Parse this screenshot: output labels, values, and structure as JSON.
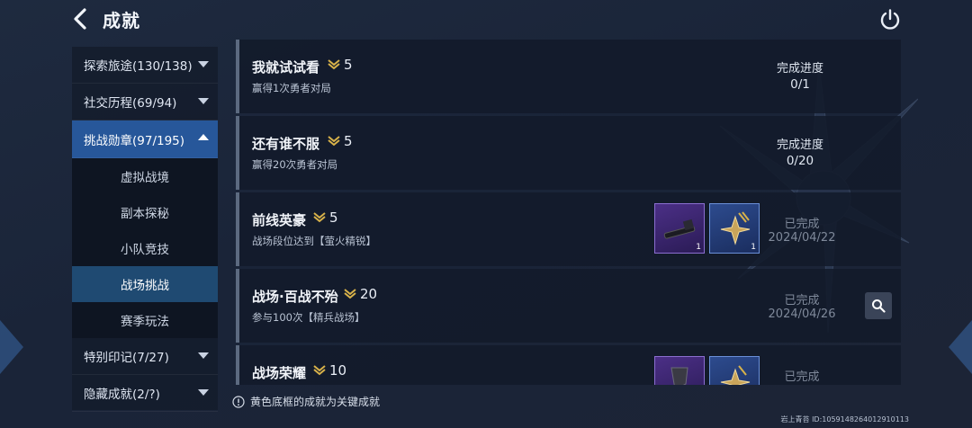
{
  "header": {
    "title": "成就"
  },
  "sidebar": {
    "categories_top": [
      {
        "label": "探索旅途(130/138)"
      },
      {
        "label": "社交历程(69/94)"
      },
      {
        "label": "挑战勋章(97/195)"
      }
    ],
    "sub_items": [
      {
        "label": "虚拟战境"
      },
      {
        "label": "副本探秘"
      },
      {
        "label": "小队竞技"
      },
      {
        "label": "战场挑战"
      },
      {
        "label": "赛季玩法"
      }
    ],
    "categories_bottom": [
      {
        "label": "特别印记(7/27)"
      },
      {
        "label": "隐藏成就(2/?)"
      }
    ]
  },
  "achievements": [
    {
      "name": "我就试试看",
      "points": "5",
      "desc": "赢得1次勇者对局",
      "progress_label": "完成进度",
      "progress": "0/1"
    },
    {
      "name": "还有谁不服",
      "points": "5",
      "desc": "赢得20次勇者对局",
      "progress_label": "完成进度",
      "progress": "0/20"
    },
    {
      "name": "前线英豪",
      "points": "5",
      "desc": "战场段位达到【萤火精锐】",
      "status": "已完成",
      "date": "2024/04/22",
      "rewards": [
        {
          "qty": "1",
          "icon": "weapon-icon",
          "color": "#4b2f86"
        },
        {
          "qty": "1",
          "icon": "badge-icon",
          "color": "#2d4b8e"
        }
      ]
    },
    {
      "name": "战场·百战不殆",
      "points": "20",
      "desc": "参与100次【精兵战场】",
      "status": "已完成",
      "date": "2024/04/26"
    },
    {
      "name": "战场荣耀",
      "points": "10",
      "status": "已完成"
    }
  ],
  "footer": {
    "note": "黄色底框的成就为关键成就",
    "uid": "岩上青苔  ID:1059148264012910113"
  },
  "colors": {
    "accent": "#27579a",
    "active_sub": "#1f4a72",
    "medal": "#d8b24a"
  }
}
